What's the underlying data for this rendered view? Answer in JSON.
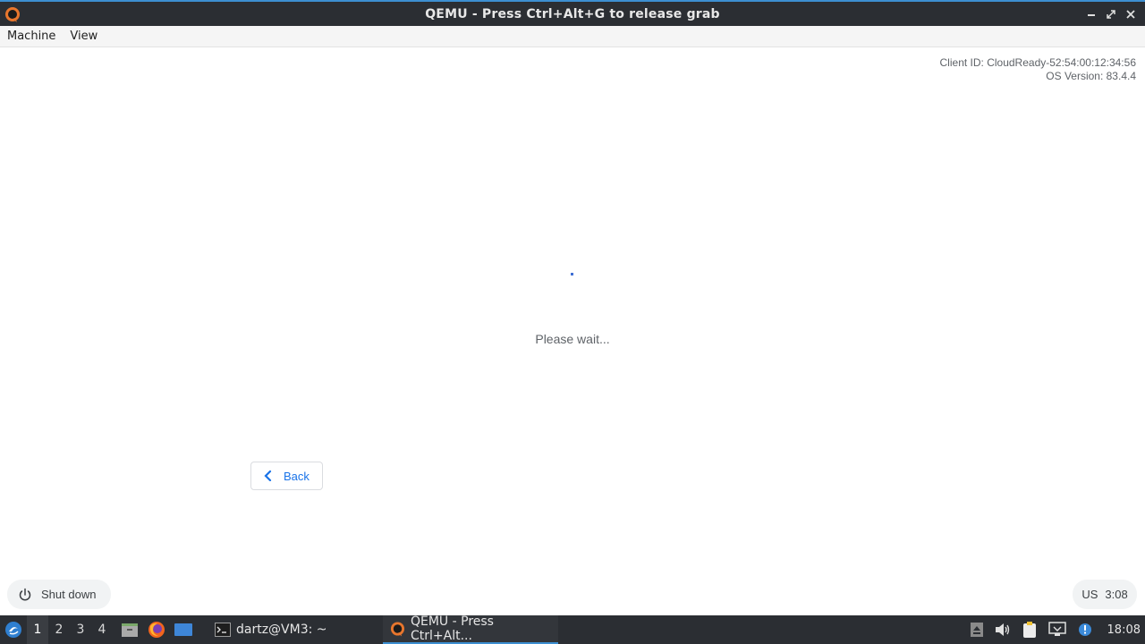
{
  "window": {
    "title": "QEMU - Press Ctrl+Alt+G to release grab"
  },
  "menu": {
    "items": [
      "Machine",
      "View"
    ]
  },
  "guest": {
    "client_id": "Client ID: CloudReady-52:54:00:12:34:56",
    "os_version": "OS Version: 83.4.4",
    "status_text": "Please wait...",
    "back_label": "Back",
    "shutdown_label": "Shut down",
    "keyboard_layout": "US",
    "time": "3:08"
  },
  "taskbar": {
    "workspaces": [
      "1",
      "2",
      "3",
      "4"
    ],
    "active_workspace": "1",
    "tasks": [
      {
        "label": "dartz@VM3: ~",
        "icon": "terminal-icon"
      },
      {
        "label": "QEMU - Press Ctrl+Alt...",
        "icon": "qemu-icon"
      }
    ],
    "clock": "18:08"
  },
  "colors": {
    "titlebar_bg": "#2b2e33",
    "accent": "#3d8fd1",
    "link_blue": "#1a73e8",
    "muted_text": "#5f6368"
  }
}
